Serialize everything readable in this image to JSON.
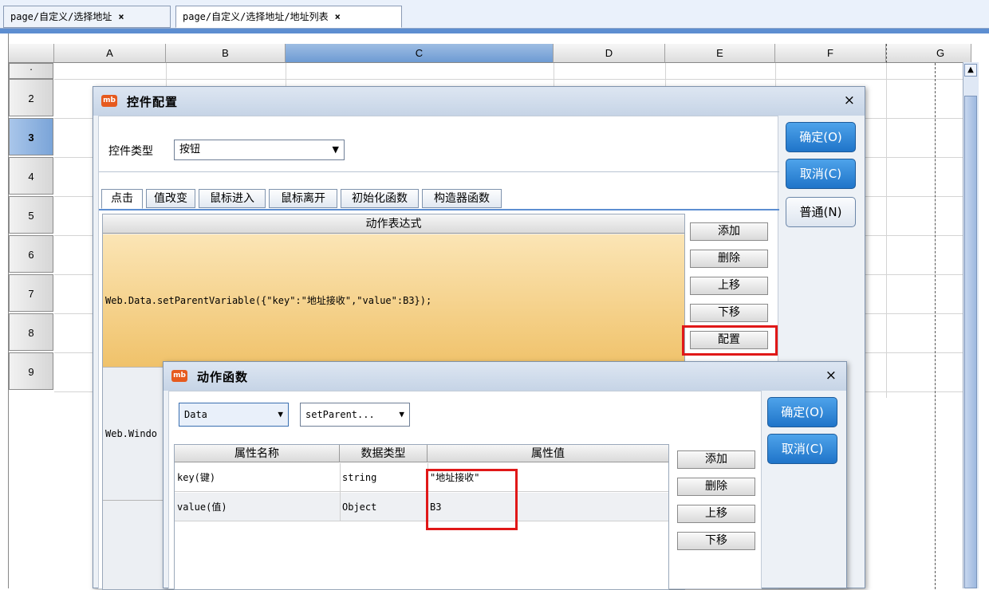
{
  "tabs": [
    {
      "label": "page/自定义/选择地址",
      "close": "×"
    },
    {
      "label": "page/自定义/选择地址/地址列表",
      "close": "×"
    }
  ],
  "sheet": {
    "columns": [
      "A",
      "B",
      "C",
      "D",
      "E",
      "F",
      "G"
    ],
    "rows": [
      "2",
      "3",
      "4",
      "5",
      "6",
      "7",
      "8",
      "9"
    ],
    "selected_column": "C",
    "selected_row": "3"
  },
  "control_dialog": {
    "title": "控件配置",
    "close": "×",
    "type_label": "控件类型",
    "type_value": "按钮",
    "ok": "确定(O)",
    "cancel": "取消(C)",
    "normal": "普通(N)",
    "event_tabs": [
      "点击",
      "值改变",
      "鼠标进入",
      "鼠标离开",
      "初始化函数",
      "构造器函数"
    ],
    "expr_header": "动作表达式",
    "expr_row1": "Web.Data.setParentVariable({\"key\":\"地址接收\",\"value\":B3});",
    "expr_row2": "Web.Windo",
    "buttons": [
      "添加",
      "删除",
      "上移",
      "下移",
      "配置"
    ]
  },
  "action_dialog": {
    "title": "动作函数",
    "close": "×",
    "module_value": "Data",
    "function_value": "setParent...",
    "ok": "确定(O)",
    "cancel": "取消(C)",
    "headers": [
      "属性名称",
      "数据类型",
      "属性值"
    ],
    "rows": [
      [
        "key(键)",
        "string",
        "\"地址接收\""
      ],
      [
        "value(值)",
        "Object",
        "B3"
      ]
    ],
    "buttons": [
      "添加",
      "删除",
      "上移",
      "下移"
    ]
  }
}
